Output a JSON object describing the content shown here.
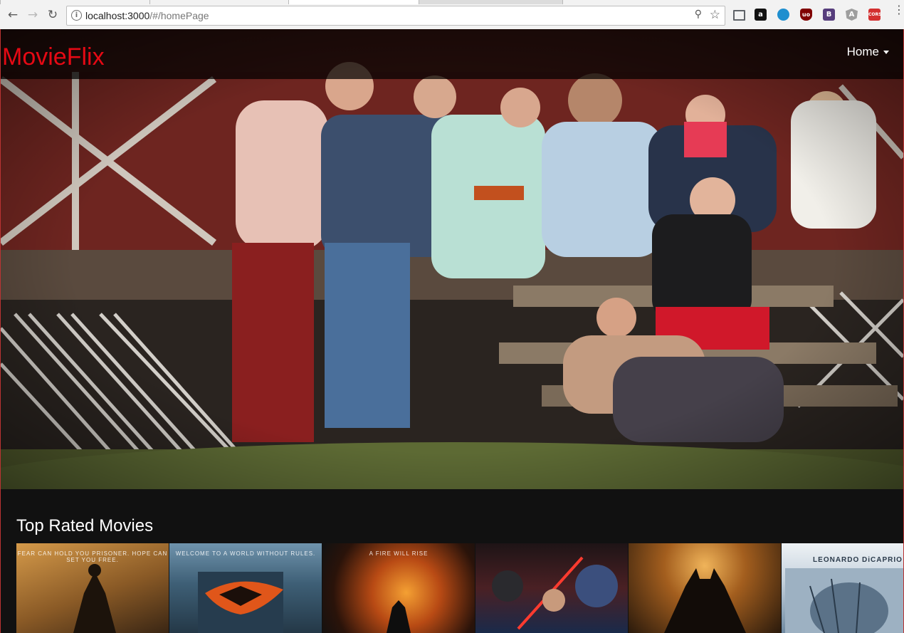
{
  "browser": {
    "back_icon": "arrow-left-icon",
    "forward_icon": "arrow-right-icon",
    "reload_icon": "reload-icon",
    "url_host": "localhost:3000",
    "url_path": "/#/homePage",
    "extensions": [
      {
        "name": "cast-icon",
        "label": "",
        "color": "#5f6368"
      },
      {
        "name": "amazon-icon",
        "label": "a",
        "color": "#111111"
      },
      {
        "name": "tracker-icon",
        "label": "",
        "color": "#1f8fcf"
      },
      {
        "name": "ublock-icon",
        "label": "uo",
        "color": "#800000"
      },
      {
        "name": "bootstrap-icon",
        "label": "B",
        "color": "#563d7c"
      },
      {
        "name": "angular-icon",
        "label": "A",
        "color": "#9e9e9e"
      },
      {
        "name": "cors-icon",
        "label": "CORS",
        "color": "#d32f2f"
      }
    ]
  },
  "site": {
    "brand": "MovieFlix",
    "nav_home": "Home",
    "brand_color": "#e50914"
  },
  "section": {
    "title": "Top Rated Movies"
  },
  "posters": [
    {
      "name": "poster-shawshank",
      "tagline": "FEAR CAN HOLD YOU PRISONER. HOPE CAN SET YOU FREE.",
      "colors": [
        "#c78a3a",
        "#6b4a22"
      ]
    },
    {
      "name": "poster-dark-knight",
      "tagline": "WELCOME TO A WORLD WITHOUT RULES.",
      "colors": [
        "#3d6b8a",
        "#b5481a"
      ]
    },
    {
      "name": "poster-dark-knight-rises",
      "tagline": "A FIRE WILL RISE",
      "colors": [
        "#1a1a1a",
        "#d26a1e"
      ]
    },
    {
      "name": "poster-force-awakens",
      "tagline": "",
      "colors": [
        "#2a1a1a",
        "#7a2a2a"
      ]
    },
    {
      "name": "poster-batman-begins",
      "tagline": "",
      "colors": [
        "#c07a2a",
        "#3a2210"
      ]
    },
    {
      "name": "poster-revenant",
      "tagline": "LEONARDO DiCAPRIO",
      "colors": [
        "#dfe7ee",
        "#7d97ad"
      ]
    }
  ]
}
